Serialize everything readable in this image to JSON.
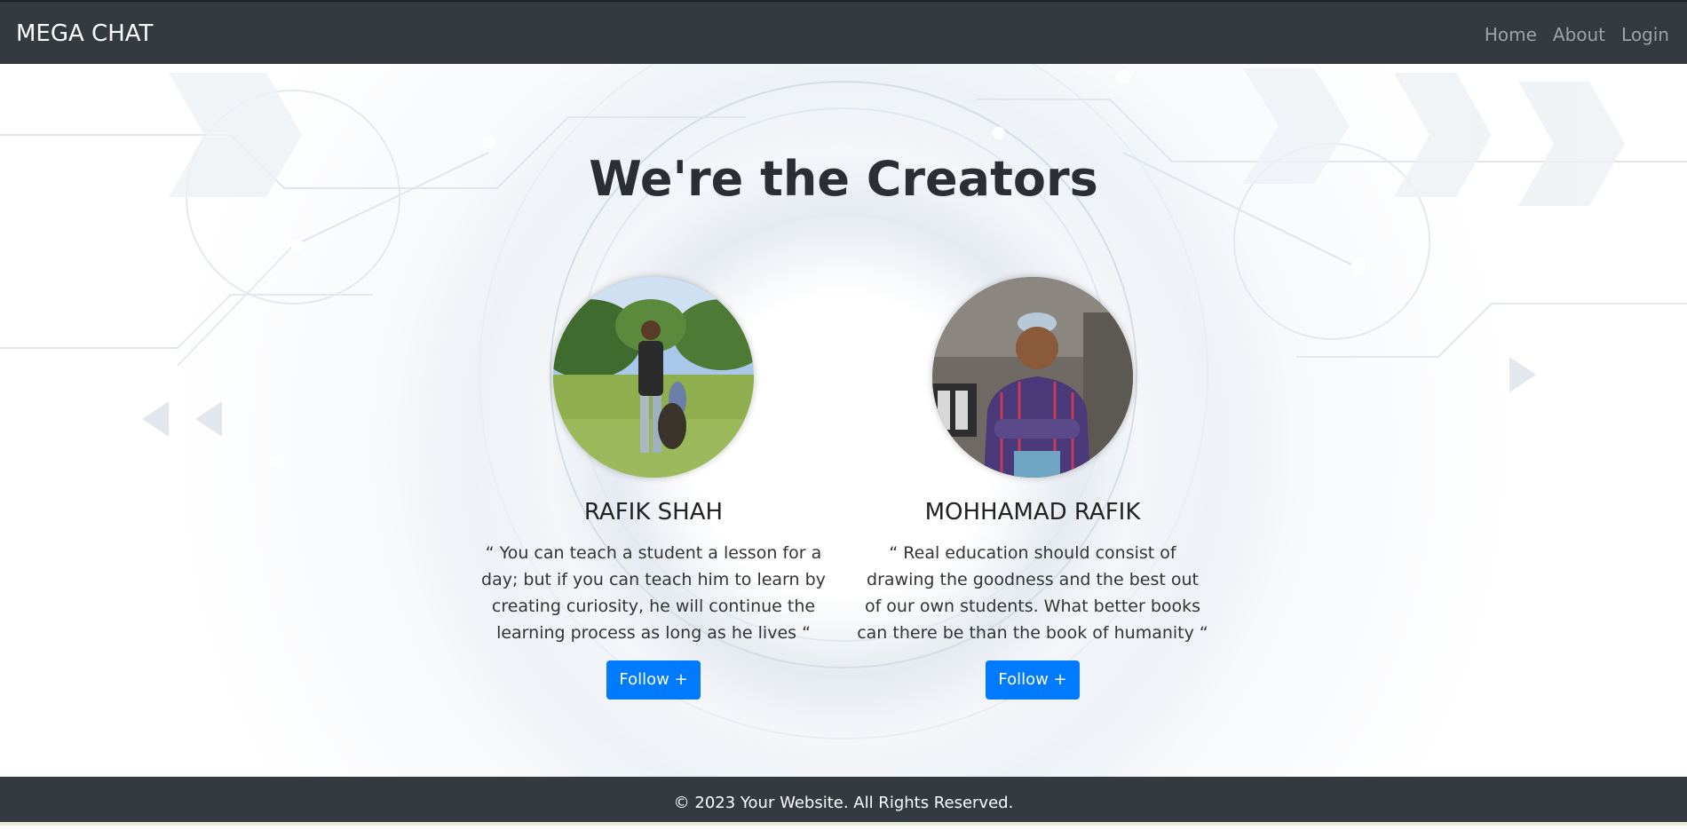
{
  "navbar": {
    "brand": "MEGA CHAT",
    "links": [
      "Home",
      "About",
      "Login"
    ]
  },
  "hero": {
    "headline": "We're the Creators"
  },
  "creators": [
    {
      "name": "RAFIK SHAH",
      "quote": "“ You can teach a student a lesson for a day; but if you can teach him to learn by creating curiosity, he will continue the learning process as long as he lives “",
      "button": "Follow +"
    },
    {
      "name": "MOHHAMAD RAFIK",
      "quote": "“ Real education should consist of drawing the goodness and the best out of our own students. What better books can there be than the book of humanity “",
      "button": "Follow +"
    }
  ],
  "footer": {
    "text": "© 2023 Your Website. All Rights Reserved."
  },
  "colors": {
    "navbar_bg": "#343a40",
    "button_bg": "#007bff",
    "nav_link": "#9da3a9"
  }
}
